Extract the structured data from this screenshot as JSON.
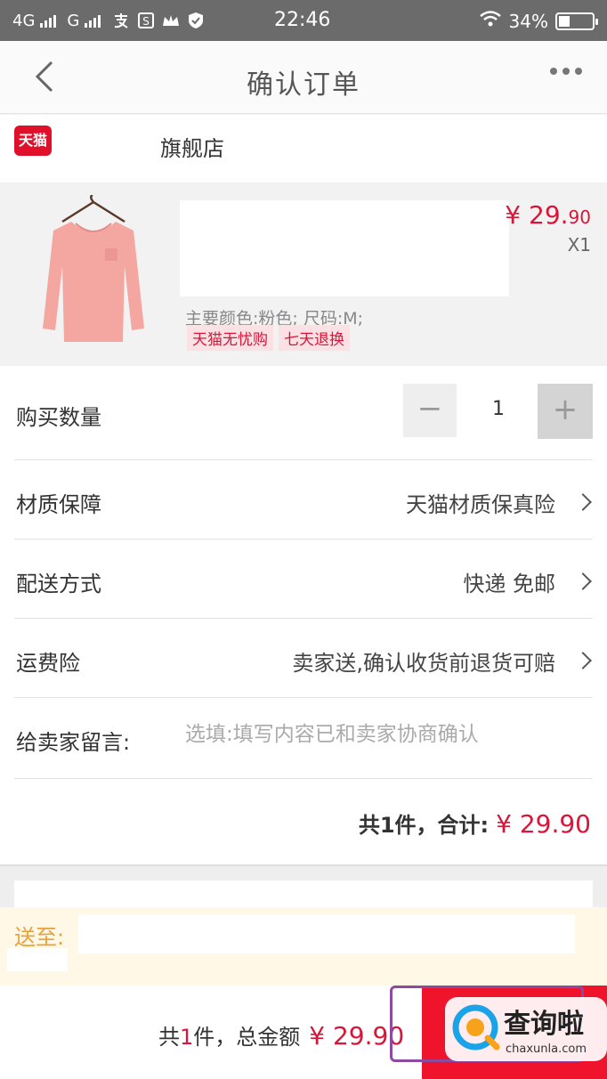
{
  "status_bar": {
    "network_1": "4G",
    "network_2": "G",
    "time": "22:46",
    "battery": "34%"
  },
  "nav": {
    "title": "确认订单"
  },
  "shop": {
    "logo_text": "天猫",
    "name": "旗舰店"
  },
  "product": {
    "price_main": "¥ 29.",
    "price_decimal": "90",
    "quantity_label": "X1",
    "spec": "主要颜色:粉色; 尺码:M;",
    "tags": [
      "天猫无忧购",
      "七天退换"
    ],
    "image_icon": "pink-long-sleeve-shirt"
  },
  "order_rows": {
    "quantity": {
      "label": "购买数量",
      "value": "1",
      "minus": "−",
      "plus": "+"
    },
    "material": {
      "label": "材质保障",
      "value": "天猫材质保真险"
    },
    "delivery": {
      "label": "配送方式",
      "value": "快递 免邮"
    },
    "freight_insurance": {
      "label": "运费险",
      "value": "卖家送,确认收货前退货可赔"
    },
    "message": {
      "label": "给卖家留言:",
      "placeholder": "选填:填写内容已和卖家协商确认"
    }
  },
  "subtotal": {
    "label": "共1件，合计:",
    "amount": "¥ 29.90"
  },
  "address": {
    "label": "送至:"
  },
  "bottom_bar": {
    "prefix": "共",
    "count": "1",
    "suffix": "件，总金额",
    "amount": "¥ 29.90"
  },
  "watermark": {
    "text": "查询啦",
    "url": "chaxunla.com"
  },
  "colors": {
    "accent_red": "#d9163a",
    "submit_red": "#f0132c",
    "address_label": "#e8a23a",
    "highlight_box": "#8e4aa0"
  }
}
